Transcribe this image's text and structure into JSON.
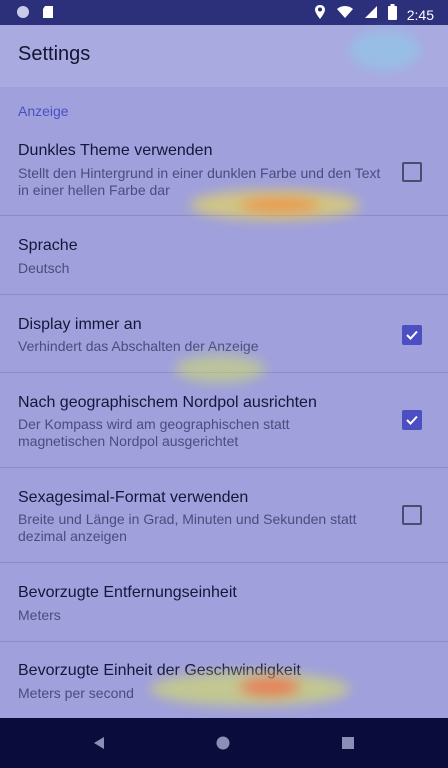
{
  "status_bar": {
    "time": "2:45",
    "icons": [
      "circle-icon",
      "sd-card-icon",
      "location-icon",
      "wifi-icon",
      "signal-icon",
      "battery-icon"
    ]
  },
  "header": {
    "title": "Settings"
  },
  "section": {
    "title": "Anzeige"
  },
  "preferences": [
    {
      "title": "Dunkles Theme verwenden",
      "summary": "Stellt den Hintergrund in einer dunklen Farbe und den Text in einer hellen Farbe dar",
      "checked": false
    },
    {
      "title": "Sprache",
      "summary": "Deutsch"
    },
    {
      "title": "Display immer an",
      "summary": "Verhindert das Abschalten der Anzeige",
      "checked": true
    },
    {
      "title": "Nach geographischem Nordpol ausrichten",
      "summary": "Der Kompass wird am geographischen statt magnetischen Nordpol ausgerichtet",
      "checked": true
    },
    {
      "title": "Sexagesimal-Format verwenden",
      "summary": "Breite und Länge in Grad, Minuten und Sekunden statt dezimal anzeigen",
      "checked": false
    },
    {
      "title": "Bevorzugte Entfernungseinheit",
      "summary": "Meters"
    },
    {
      "title": "Bevorzugte Einheit der Geschwindigkeit",
      "summary": "Meters per second"
    }
  ],
  "colors": {
    "accent": "#4b4fc2",
    "status_bar": "#2c2f7a",
    "nav_bar": "#0a0d3c"
  },
  "nav": {
    "icons": [
      "back-icon",
      "home-icon",
      "recents-icon"
    ]
  }
}
